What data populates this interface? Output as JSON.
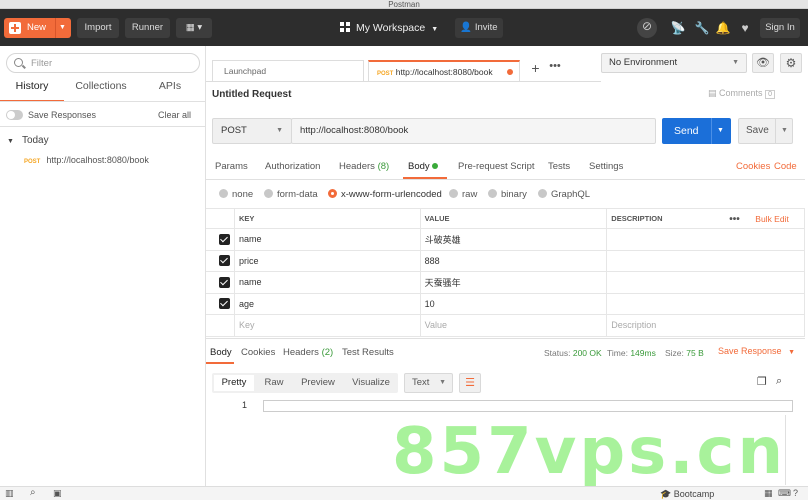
{
  "window": {
    "title": "Postman"
  },
  "header": {
    "new_label": "New",
    "import_label": "Import",
    "runner_label": "Runner",
    "workspace_label": "My Workspace",
    "invite_label": "Invite",
    "signin_label": "Sign In"
  },
  "sidebar": {
    "filter_placeholder": "Filter",
    "tabs": [
      "History",
      "Collections",
      "APIs"
    ],
    "save_responses": "Save Responses",
    "clear_all": "Clear all",
    "group": "Today",
    "items": [
      {
        "method": "POST",
        "url": "http://localhost:8080/book"
      }
    ]
  },
  "tabs": [
    {
      "label": "Launchpad"
    },
    {
      "method": "POST",
      "label": "http://localhost:8080/book"
    }
  ],
  "environment": {
    "selected": "No Environment"
  },
  "request": {
    "name": "Untitled Request",
    "comments_label": "Comments",
    "comments_count": "0",
    "method": "POST",
    "url": "http://localhost:8080/book",
    "send_label": "Send",
    "save_label": "Save"
  },
  "request_tabs": {
    "params": "Params",
    "authorization": "Authorization",
    "headers": "Headers",
    "headers_count": "(8)",
    "body": "Body",
    "prerequest": "Pre-request Script",
    "tests": "Tests",
    "settings": "Settings",
    "cookies": "Cookies",
    "code": "Code"
  },
  "body_types": [
    "none",
    "form-data",
    "x-www-form-urlencoded",
    "raw",
    "binary",
    "GraphQL"
  ],
  "params_table": {
    "headers": [
      "KEY",
      "VALUE",
      "DESCRIPTION"
    ],
    "bulk_edit": "Bulk Edit",
    "rows": [
      {
        "key": "name",
        "value": "斗破英雄"
      },
      {
        "key": "price",
        "value": "888"
      },
      {
        "key": "name",
        "value": "天蚕骚年"
      },
      {
        "key": "age",
        "value": "10"
      }
    ],
    "placeholder": {
      "key": "Key",
      "value": "Value",
      "description": "Description"
    }
  },
  "response": {
    "tabs": {
      "body": "Body",
      "cookies": "Cookies",
      "headers": "Headers",
      "headers_count": "(2)",
      "test_results": "Test Results"
    },
    "status_label": "Status:",
    "status": "200 OK",
    "time_label": "Time:",
    "time": "149ms",
    "size_label": "Size:",
    "size": "75 B",
    "save_response": "Save Response",
    "views": [
      "Pretty",
      "Raw",
      "Preview",
      "Visualize"
    ],
    "format": "Text",
    "line_number": "1"
  },
  "footer": {
    "bootcamp": "Bootcamp"
  },
  "watermark": "857vps.cn"
}
